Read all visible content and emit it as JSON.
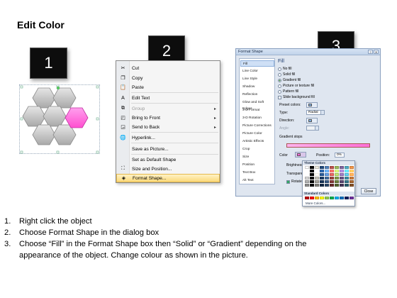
{
  "title": "Edit Color",
  "badges": [
    "1",
    "2",
    "3"
  ],
  "colors": {
    "pink": "#ff66dd",
    "hex_grey": "#bdbdbd",
    "menu_highlight": "#fbd97a",
    "dialog_bg": "#dfe6f0"
  },
  "context_menu": {
    "items": [
      {
        "label": "Cut",
        "icon": "scissors-icon"
      },
      {
        "label": "Copy",
        "icon": "copy-icon"
      },
      {
        "label": "Paste",
        "icon": "paste-icon"
      },
      {
        "label": "Edit Text",
        "icon": "edit-text-icon"
      },
      {
        "label": "Group",
        "icon": "group-icon",
        "disabled": true,
        "submenu": true
      },
      {
        "label": "Bring to Front",
        "icon": "bring-to-front-icon",
        "submenu": true
      },
      {
        "label": "Send to Back",
        "icon": "send-to-back-icon",
        "submenu": true
      },
      {
        "label": "Hyperlink...",
        "icon": "hyperlink-icon"
      },
      {
        "label": "Save as Picture...",
        "icon": ""
      },
      {
        "label": "Set as Default Shape",
        "icon": ""
      },
      {
        "label": "Size and Position...",
        "icon": "size-position-icon"
      },
      {
        "label": "Format Shape...",
        "icon": "format-shape-icon",
        "highlighted": true
      }
    ]
  },
  "dialog": {
    "title": "Format Shape",
    "categories": [
      "Fill",
      "Line Color",
      "Line Style",
      "Shadow",
      "Reflection",
      "Glow and Soft Edges",
      "3-D Format",
      "3-D Rotation",
      "Picture Corrections",
      "Picture Color",
      "Artistic Effects",
      "Crop",
      "Size",
      "Position",
      "Text Box",
      "Alt Text"
    ],
    "pane_title": "Fill",
    "fill_options": [
      "No fill",
      "Solid fill",
      "Gradient fill",
      "Picture or texture fill",
      "Pattern fill",
      "Slide background fill"
    ],
    "preset_colors_label": "Preset colors:",
    "type_label": "Type:",
    "type_value": "Radial",
    "direction_label": "Direction:",
    "angle_label": "Angle:",
    "gradient_stops_label": "Gradient stops",
    "color_label": "Color",
    "position_label": "Position:",
    "position_value": "0%",
    "brightness_label": "Brightness",
    "transparency_label": "Transparency",
    "rotate_label": "Rotate with shape",
    "close_label": "Close",
    "palette": {
      "theme_title": "Theme Colors",
      "standard_title": "Standard Colors",
      "more_colors": "More Colors..."
    }
  },
  "steps": [
    {
      "num": "1.",
      "text": "Right click the object"
    },
    {
      "num": "2.",
      "text": "Choose Format Shape in the dialog box"
    },
    {
      "num": "3.",
      "text": "Choose “Fill” in the Format Shape box then “Solid” or “Gradient” depending on the"
    },
    {
      "num": "",
      "text": "appearance of the object. Change colour as shown in the picture."
    }
  ]
}
